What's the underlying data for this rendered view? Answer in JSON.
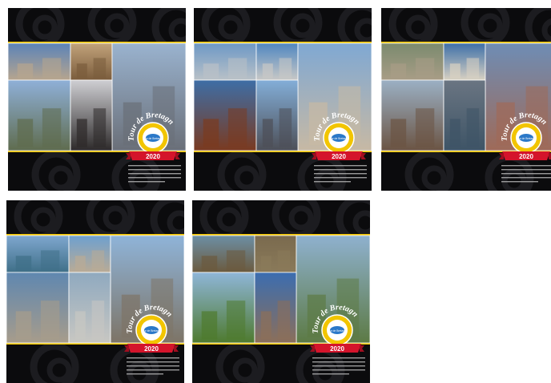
{
  "cards": [
    {
      "title": "Tour de Bretagne",
      "year": "2020",
      "badge": "Tour de Bretagne",
      "accent": "#f2c500",
      "ribbon": "#d4142b",
      "photos": [
        {
          "c1": "#5b83b8",
          "c2": "#b7a58e"
        },
        {
          "c1": "#c2a37b",
          "c2": "#7a5c3c"
        },
        {
          "c1": "#9ab3cf",
          "c2": "#6a6f78"
        },
        {
          "c1": "#8fb0d8",
          "c2": "#5f6c4e"
        },
        {
          "c1": "#cfcfd3",
          "c2": "#2d2a2a"
        },
        {
          "c1": "#9fb8d6",
          "c2": "#4c4e56"
        }
      ]
    },
    {
      "title": "Tour de Bretagne",
      "year": "2020",
      "badge": "Tour de Bretagne",
      "accent": "#f2c500",
      "ribbon": "#d4142b",
      "photos": [
        {
          "c1": "#6d98c6",
          "c2": "#b9c1c7"
        },
        {
          "c1": "#4f86c0",
          "c2": "#c8c8c6"
        },
        {
          "c1": "#7fa8d3",
          "c2": "#c7b9a4"
        },
        {
          "c1": "#3e6ea6",
          "c2": "#7a3a20"
        },
        {
          "c1": "#83aed8",
          "c2": "#4d4f57"
        },
        {
          "c1": "#5f8ab8",
          "c2": "#2d6e52"
        }
      ]
    },
    {
      "title": "Tour de Bretagne",
      "year": "2020",
      "badge": "Tour de Bretagne",
      "accent": "#f2c500",
      "ribbon": "#d4142b",
      "photos": [
        {
          "c1": "#7b8a6e",
          "c2": "#a89d86"
        },
        {
          "c1": "#3d6fa8",
          "c2": "#d8d1c2"
        },
        {
          "c1": "#6e8db5",
          "c2": "#9f6a58"
        },
        {
          "c1": "#9bb0c4",
          "c2": "#6b5443"
        },
        {
          "c1": "#6a7582",
          "c2": "#3e5466"
        },
        {
          "c1": "#5a6b7c",
          "c2": "#b04d3e"
        }
      ]
    },
    {
      "title": "Tour de Bretagne",
      "year": "2020",
      "badge": "Tour de Bretagne",
      "accent": "#f2c500",
      "ribbon": "#d4142b",
      "photos": [
        {
          "c1": "#7fa7cf",
          "c2": "#3f6f88"
        },
        {
          "c1": "#6ea0cf",
          "c2": "#b9ab96"
        },
        {
          "c1": "#8fb4d9",
          "c2": "#7d7466"
        },
        {
          "c1": "#5f87b0",
          "c2": "#a79c8b"
        },
        {
          "c1": "#8fa9bf",
          "c2": "#c8c7c2"
        },
        {
          "c1": "#7ea6cb",
          "c2": "#c9b99a"
        }
      ]
    },
    {
      "title": "Tour de Bretagne",
      "year": "2020",
      "badge": "Tour de Bretagne",
      "accent": "#f2c500",
      "ribbon": "#d4142b",
      "photos": [
        {
          "c1": "#6c8fa5",
          "c2": "#6b5a3e"
        },
        {
          "c1": "#7a6a4e",
          "c2": "#8a7a5a"
        },
        {
          "c1": "#8fb1cf",
          "c2": "#5c7a44"
        },
        {
          "c1": "#8fb6d9",
          "c2": "#4e7a2e"
        },
        {
          "c1": "#3b6db0",
          "c2": "#8c6f5a"
        },
        {
          "c1": "#7a8f62",
          "c2": "#5d6b3c"
        }
      ]
    }
  ]
}
